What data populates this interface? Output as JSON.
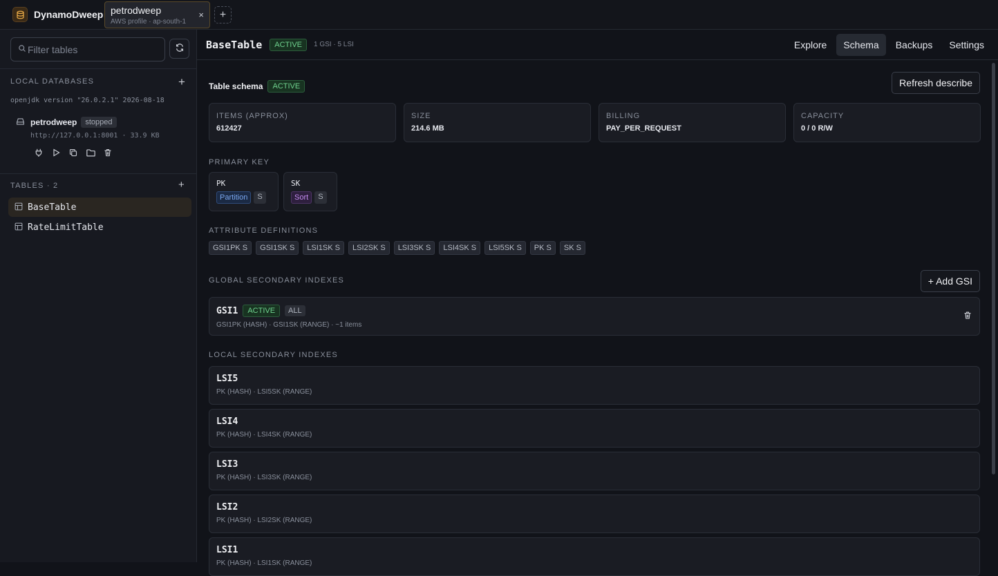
{
  "app": {
    "title": "DynamoDweep"
  },
  "connection_tab": {
    "name": "petrodweep",
    "subtitle": "AWS profile · ap-south-1",
    "close": "×"
  },
  "add_tab_label": "+",
  "sidebar": {
    "filter_placeholder": "Filter tables",
    "local_databases": {
      "heading": "LOCAL DATABASES",
      "version": "openjdk version \"26.0.2.1\" 2026-08-18",
      "databases": [
        {
          "name": "petrodweep",
          "status": "stopped",
          "url": "http://127.0.0.1:8001 · 33.9 KB"
        }
      ]
    },
    "tables": {
      "heading": "TABLES · 2",
      "items": [
        {
          "label": "BaseTable",
          "active": true
        },
        {
          "label": "RateLimitTable",
          "active": false
        }
      ]
    }
  },
  "main": {
    "table_name": "BaseTable",
    "status": "ACTIVE",
    "index_summary": "1 GSI · 5 LSI",
    "tabs": [
      {
        "label": "Explore"
      },
      {
        "label": "Schema",
        "active": true
      },
      {
        "label": "Backups"
      },
      {
        "label": "Settings"
      }
    ],
    "schema_label": "Table schema",
    "schema_status": "ACTIVE",
    "refresh_button": "Refresh describe",
    "stats": [
      {
        "label": "ITEMS (APPROX)",
        "value": "612427"
      },
      {
        "label": "SIZE",
        "value": "214.6 MB"
      },
      {
        "label": "BILLING",
        "value": "PAY_PER_REQUEST"
      },
      {
        "label": "CAPACITY",
        "value": "0 / 0 R/W"
      }
    ],
    "primary_key": {
      "heading": "PRIMARY KEY",
      "keys": [
        {
          "name": "PK",
          "role": "Partition",
          "type": "S"
        },
        {
          "name": "SK",
          "role": "Sort",
          "type": "S"
        }
      ]
    },
    "attribute_definitions": {
      "heading": "ATTRIBUTE DEFINITIONS",
      "items": [
        "GSI1PK S",
        "GSI1SK S",
        "LSI1SK S",
        "LSI2SK S",
        "LSI3SK S",
        "LSI4SK S",
        "LSI5SK S",
        "PK S",
        "SK S"
      ]
    },
    "gsi": {
      "heading": "GLOBAL SECONDARY INDEXES",
      "add_label": "+ Add GSI",
      "items": [
        {
          "name": "GSI1",
          "status": "ACTIVE",
          "projection": "ALL",
          "desc": "GSI1PK (HASH) · GSI1SK (RANGE) · ~1 items"
        }
      ]
    },
    "lsi": {
      "heading": "LOCAL SECONDARY INDEXES",
      "items": [
        {
          "name": "LSI5",
          "desc": "PK (HASH) · LSI5SK (RANGE)"
        },
        {
          "name": "LSI4",
          "desc": "PK (HASH) · LSI4SK (RANGE)"
        },
        {
          "name": "LSI3",
          "desc": "PK (HASH) · LSI3SK (RANGE)"
        },
        {
          "name": "LSI2",
          "desc": "PK (HASH) · LSI2SK (RANGE)"
        },
        {
          "name": "LSI1",
          "desc": "PK (HASH) · LSI1SK (RANGE)"
        }
      ]
    }
  }
}
